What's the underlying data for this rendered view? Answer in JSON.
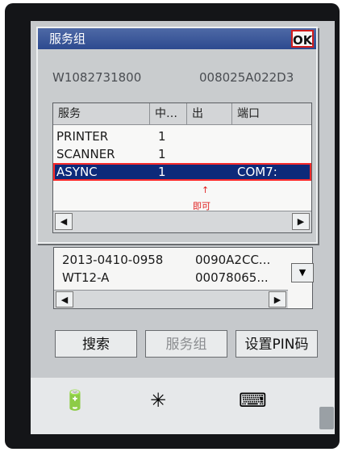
{
  "dialog": {
    "title": "服务组",
    "ok_label": "OK",
    "device_id": "W1082731800",
    "device_mac": "008025A022D3",
    "columns": [
      "服务",
      "中…",
      "出",
      "端口"
    ],
    "rows": [
      {
        "service": "PRINTER",
        "in": "1",
        "port": ""
      },
      {
        "service": "SCANNER",
        "in": "1",
        "port": ""
      },
      {
        "service": "ASYNC",
        "in": "1",
        "port": "COM7:"
      }
    ],
    "annotation": "即可",
    "arrow_glyph": "↑",
    "scroll_left": "◀",
    "scroll_right": "▶"
  },
  "devices": [
    {
      "name": "2013-0410-0958",
      "address": "0090A2CC..."
    },
    {
      "name": "WT12-A",
      "address": "00078065..."
    }
  ],
  "buttons": {
    "search": "搜索",
    "service_group": "服务组",
    "set_pin": "设置PIN码"
  },
  "dropdown_glyph": "▼"
}
